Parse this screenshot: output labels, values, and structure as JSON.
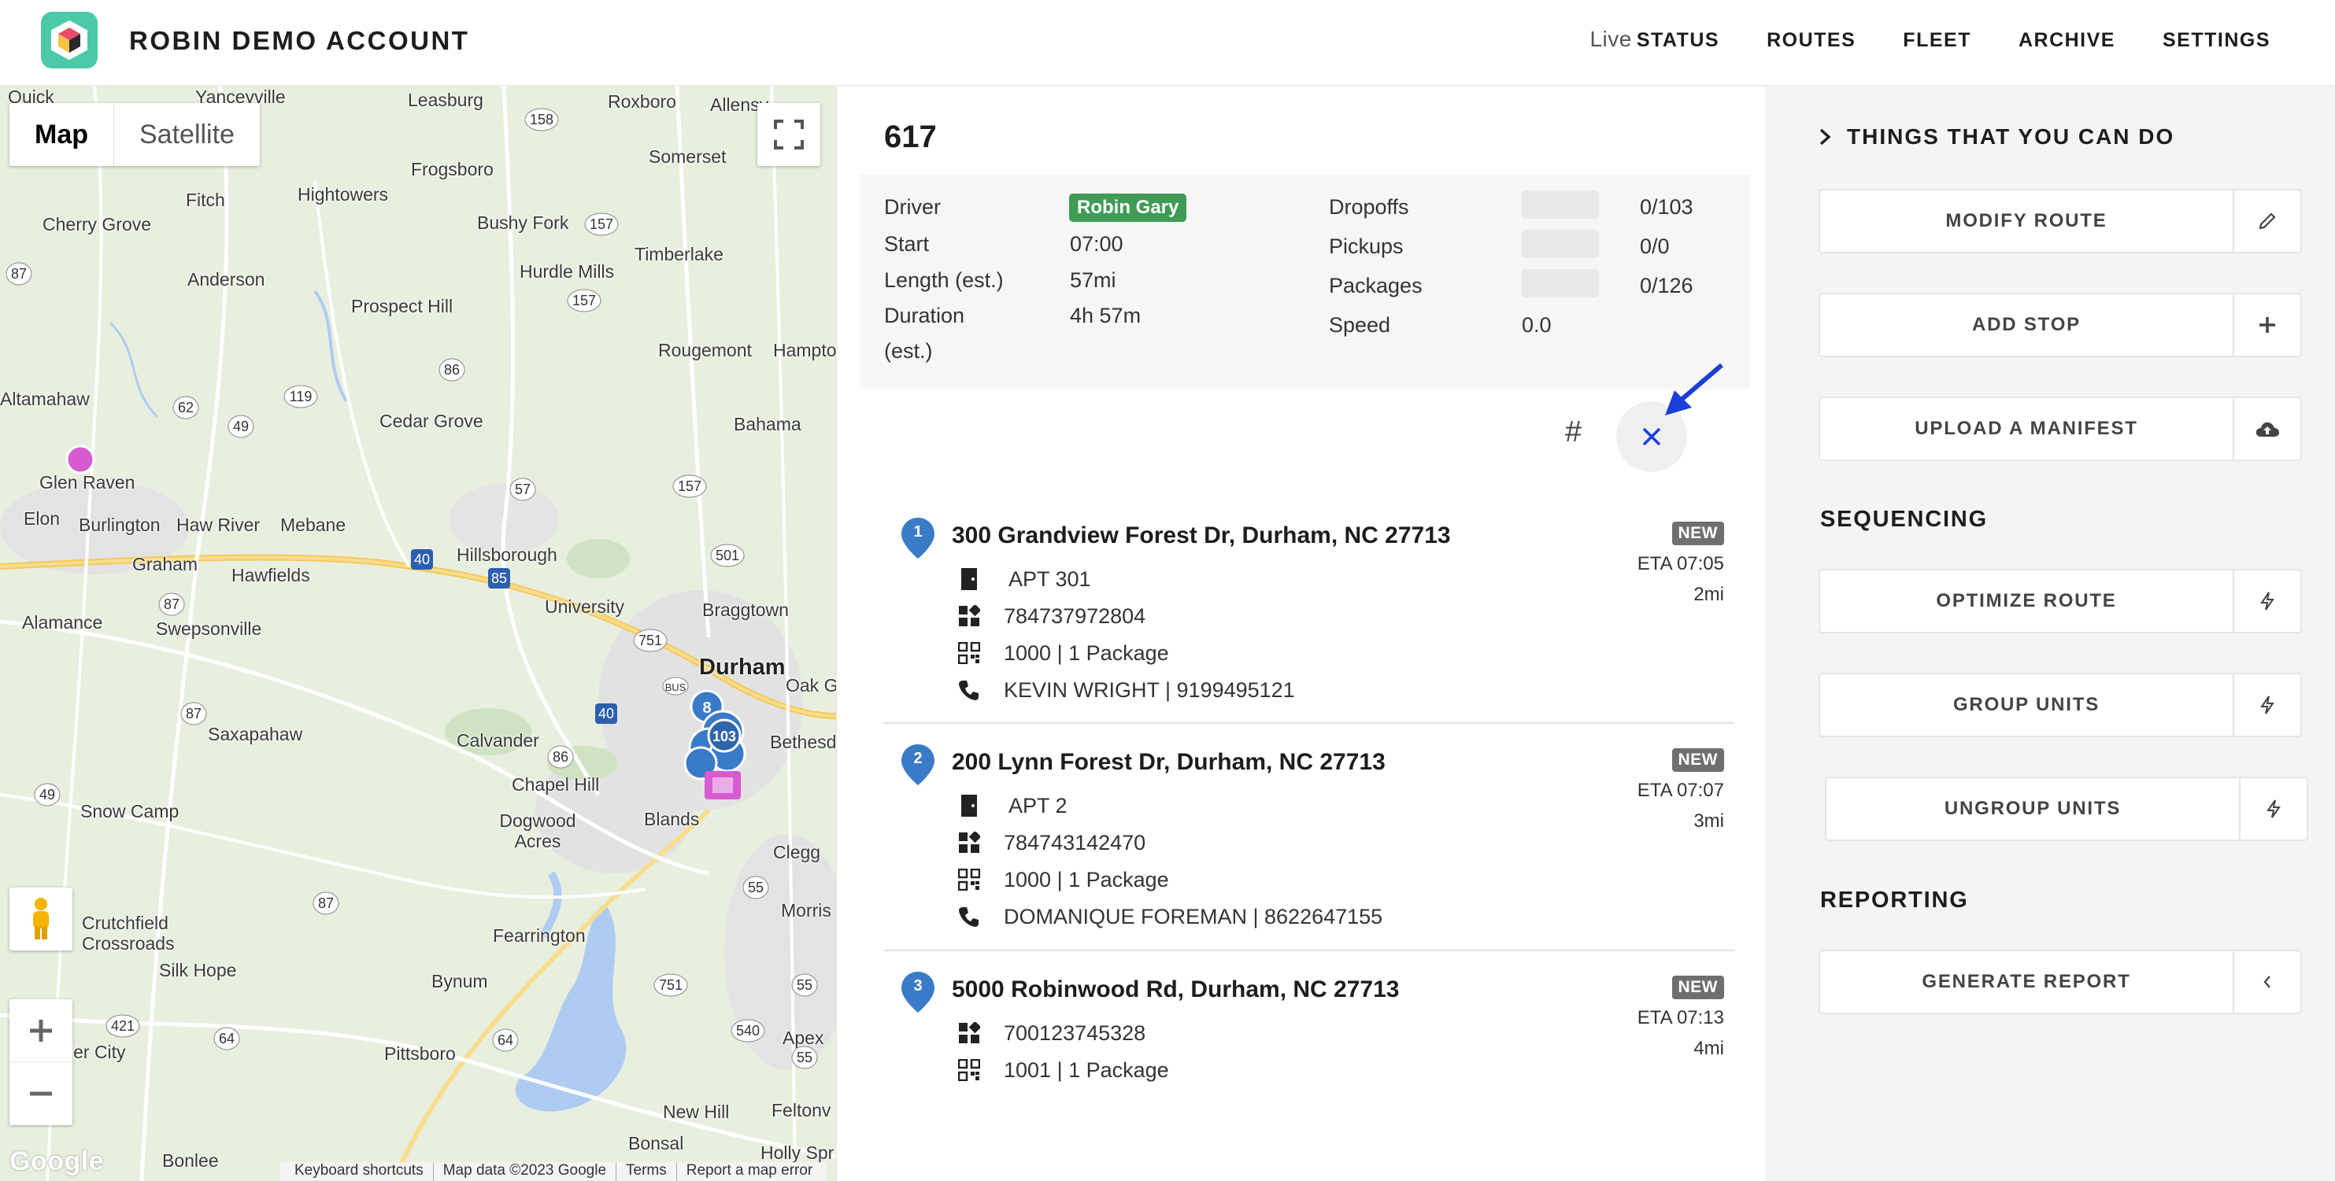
{
  "header": {
    "brand": "ROBIN DEMO ACCOUNT",
    "nav": [
      {
        "prefix": "Live",
        "label": "STATUS"
      },
      {
        "label": "ROUTES"
      },
      {
        "label": "FLEET"
      },
      {
        "label": "ARCHIVE"
      },
      {
        "label": "SETTINGS"
      }
    ]
  },
  "map": {
    "type_buttons": [
      "Map",
      "Satellite"
    ],
    "logo_text": "Google",
    "attribution": [
      "Keyboard shortcuts",
      "Map data ©2023 Google",
      "Terms",
      "Report a map error"
    ],
    "labels": {
      "quick": "Quick",
      "yanceyville": "Yanceyville",
      "leasburg": "Leasburg",
      "roxboro": "Roxboro",
      "allensv": "Allensv",
      "fitch": "Fitch",
      "hightowers": "Hightowers",
      "frogsboro": "Frogsboro",
      "somerset": "Somerset",
      "cherry_grove": "Cherry Grove",
      "bushy_fork": "Bushy Fork",
      "timberlake": "Timberlake",
      "anderson": "Anderson",
      "hurdle_mills": "Hurdle Mills",
      "prospect_hill": "Prospect Hill",
      "rougemont": "Rougemont",
      "hampto": "Hampto",
      "altamahaw": "Altamahaw",
      "cedar_grove": "Cedar Grove",
      "bahama": "Bahama",
      "glen_raven": "Glen Raven",
      "elon": "Elon",
      "burlington": "Burlington",
      "haw_river": "Haw River",
      "mebane": "Mebane",
      "graham": "Graham",
      "hawfields": "Hawfields",
      "hillsborough": "Hillsborough",
      "university": "University",
      "braggtown": "Braggtown",
      "alamance": "Alamance",
      "swepsonville": "Swepsonville",
      "durham": "Durham",
      "oak_g": "Oak G",
      "saxapahaw": "Saxapahaw",
      "calvander": "Calvander",
      "bethesd": "Bethesd",
      "chapel_hill": "Chapel Hill",
      "blands": "Blands",
      "snow_camp": "Snow Camp",
      "dogwood_acres": "Dogwood Acres",
      "clegg": "Clegg",
      "morris": "Morris",
      "crutchfield": "Crutchfield Crossroads",
      "fearrington": "Fearrington",
      "silk_hope": "Silk Hope",
      "bynum": "Bynum",
      "pittsboro": "Pittsboro",
      "apex": "Apex",
      "ler_city": "ler City",
      "new_hill": "New Hill",
      "feltonv": "Feltonv",
      "bonlee": "Bonlee",
      "bonsal": "Bonsal",
      "holly_spr": "Holly Spr"
    }
  },
  "route": {
    "title": "617",
    "driver_label": "Driver",
    "driver": "Robin Gary",
    "start_label": "Start",
    "start": "07:00",
    "length_label": "Length (est.)",
    "length": "57mi",
    "duration_label_1": "Duration",
    "duration_label_2": "(est.)",
    "duration": "4h 57m",
    "dropoffs_label": "Dropoffs",
    "dropoffs": "0/103",
    "pickups_label": "Pickups",
    "pickups": "0/0",
    "packages_label": "Packages",
    "packages": "0/126",
    "speed_label": "Speed",
    "speed": "0.0",
    "hash_symbol": "#"
  },
  "stops": [
    {
      "num": "1",
      "address": "300 Grandview Forest Dr, Durham, NC 27713",
      "apt": "APT 301",
      "barcode": "784737972804",
      "package": "1000 | 1 Package",
      "contact": "KEVIN WRIGHT | 9199495121",
      "badge": "NEW",
      "eta": "ETA 07:05",
      "distance": "2mi"
    },
    {
      "num": "2",
      "address": "200 Lynn Forest Dr, Durham, NC 27713",
      "apt": "APT 2",
      "barcode": "784743142470",
      "package": "1000 | 1 Package",
      "contact": "DOMANIQUE FOREMAN | 8622647155",
      "badge": "NEW",
      "eta": "ETA 07:07",
      "distance": "3mi"
    },
    {
      "num": "3",
      "address": "5000 Robinwood Rd, Durham, NC 27713",
      "barcode": "700123745328",
      "package": "1001 | 1 Package",
      "badge": "NEW",
      "eta": "ETA 07:13",
      "distance": "4mi"
    }
  ],
  "actions_panel": {
    "things_header": "THINGS THAT YOU CAN DO",
    "modify": "MODIFY ROUTE",
    "add_stop": "ADD STOP",
    "upload": "UPLOAD A MANIFEST",
    "sequencing_header": "SEQUENCING",
    "optimize": "OPTIMIZE ROUTE",
    "group": "GROUP UNITS",
    "ungroup": "UNGROUP UNITS",
    "reporting_header": "REPORTING",
    "report": "GENERATE REPORT"
  },
  "colors": {
    "brand_green": "#4cc9a6",
    "driver_badge": "#3f9b56",
    "pin_blue": "#3a7bc8",
    "arrow_blue": "#1a3fd8",
    "map_marker_pink": "#d65bd1"
  }
}
